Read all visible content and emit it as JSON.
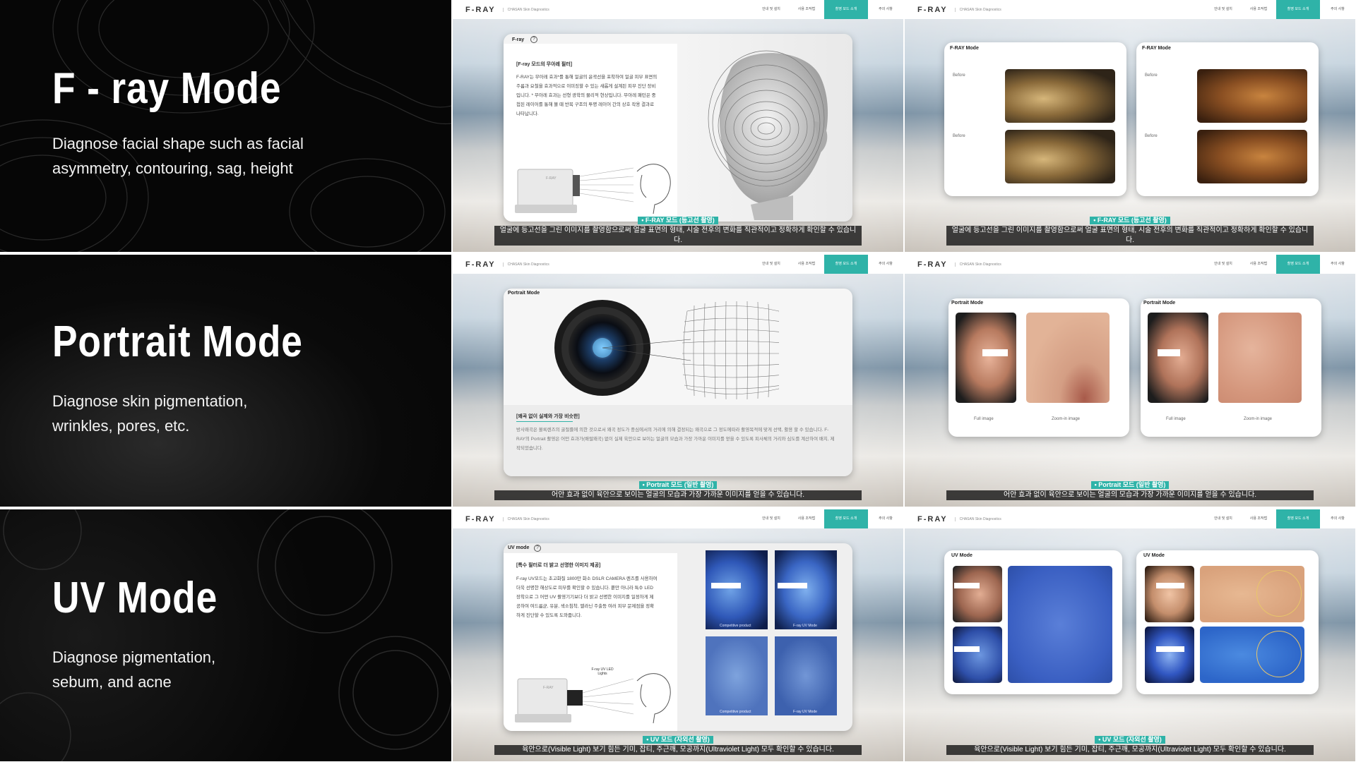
{
  "brand": {
    "logo": "F-RAY",
    "subtitle": "CHASAN Skin Diagnostics"
  },
  "nav": [
    "안내 및 설치",
    "사용 조작법",
    "촬영 모드 소개",
    "주의 사항"
  ],
  "colors": {
    "accent": "#2fb3a8",
    "left_bg": "#060606"
  },
  "rows": [
    {
      "mode_title": "F - ray Mode",
      "mode_desc": "Diagnose facial shape such as facial asymmetry, contouring, sag, height",
      "slide_a": {
        "card_tag": "F-ray",
        "info_icon": "info-icon",
        "heading": "[F-ray 모드의 무아레 필터]",
        "body": "F-RAY는 무아레 효과*를 통해 얼굴의 윤곽선을 포착하여 얼굴 피부 표면의 주름과 요철을 효과적으로 이미징할 수 있는 새롭게 설계된 피부 진단 장비입니다. * 무아레 효과는 선형 광학의 물리적 현상입니다. 무아레 패턴은 중첩된 레이어를 통해 볼 때 반복 구조의 투명 레이어 간의 상호 작용 결과로 나타납니다.",
        "device_label": "F-RAY"
      },
      "slide_b": {
        "cards": [
          {
            "tag": "F-RAY Mode",
            "labels": [
              "Before",
              "Before"
            ]
          },
          {
            "tag": "F-RAY Mode",
            "labels": [
              "Before",
              "Before"
            ]
          }
        ]
      },
      "caption_tag": "• F-RAY 모드 (등고선 촬영)",
      "caption": "얼굴에 등고선을 그린 이미지를 촬영함으로써 얼굴 표면의 형태, 시술 전후의 변화를 직관적이고 정확하게 확인할 수 있습니다."
    },
    {
      "mode_title": "Portrait Mode",
      "mode_desc": "Diagnose skin pigmentation, wrinkles, pores, etc.",
      "slide_a": {
        "card_tag": "Portrait Mode",
        "heading": "[왜곡 없이 실제와 가장 비슷한]",
        "body": "방사왜곡은 볼록렌즈의 굴절률에 의한 것으로서 왜곡 정도가 중심에서의 거리에 의해 결정되는 왜곡으로 그 정도에따라 촬영목적에 맞게 선택, 활용 할 수 있습니다. F-RAY의 Portrait 촬영은 어떤 효과가(배럴왜곡) 없이 실제 육안으로 보이는 얼굴의 모습과 가장 가까운 이미지를 얻을 수 있도록 피사체의 거리와 심도를 계산하여 배치, 제작되었습니다."
      },
      "slide_b": {
        "cards": [
          {
            "tag": "Portrait Mode",
            "labels": [
              "Full image",
              "Zoom-in image"
            ]
          },
          {
            "tag": "Portrait Mode",
            "labels": [
              "Full image",
              "Zoom-in image"
            ]
          }
        ]
      },
      "caption_tag": "• Portrait 모드 (일반 촬영)",
      "caption": "어안 효과 없이 육안으로 보이는 얼굴의 모습과 가장 가까운 이미지를 얻을 수 있습니다."
    },
    {
      "mode_title": "UV Mode",
      "mode_desc": "Diagnose pigmentation, sebum, and acne",
      "slide_a": {
        "card_tag": "UV mode",
        "info_icon": "info-icon",
        "heading": "[특수 필터로 더 밝고 선명한 이미지 제공]",
        "body": "F-ray UV모드는 초고화질 1800만 화소 DSLR CAMERA 렌즈를 사용하여 더욱 선명한 해상도로 피부를 확인할 수 있습니다. 뿐만 아니라 특수 LED 장착으로 그 어떤 UV 촬영기기보다 더 밝고 선명한 이미지를 일정하게 제공하여 여드름균, 유분, 색소침착, 멜라닌 주출등 여러 피부 문제점을 정확하게 진단할 수 있도록 도와줍니다.",
        "device_label": "F-RAY",
        "uv_label": "F-ray UV LED Lights",
        "photo_labels": [
          "Competitive product",
          "F-ray UV Mode",
          "Competitive product",
          "F-ray UV Mode"
        ]
      },
      "slide_b": {
        "cards": [
          {
            "tag": "UV Mode",
            "labels": []
          },
          {
            "tag": "UV Mode",
            "labels": []
          }
        ]
      },
      "caption_tag": "• UV 모드 (자외선 촬영)",
      "caption": "육안으로(Visible Light) 보기 힘든 기미, 잡티, 주근깨, 모공까지(Ultraviolet Light) 모두 확인할 수 있습니다."
    }
  ]
}
